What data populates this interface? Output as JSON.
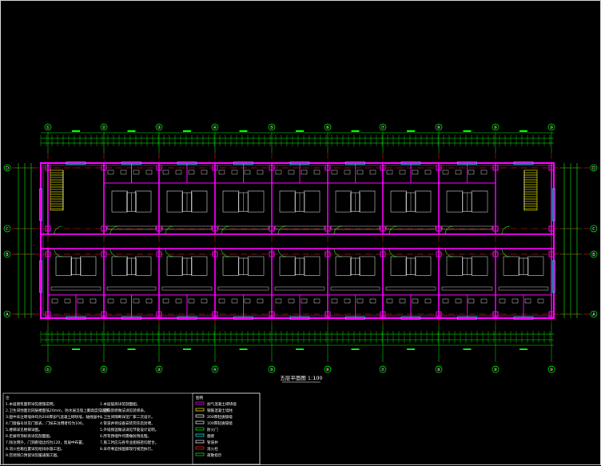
{
  "drawing": {
    "title": "五层平面图 1:100",
    "axis_labels_horizontal": [
      "①",
      "②",
      "③",
      "④",
      "⑤",
      "⑥",
      "⑦",
      "⑧",
      "⑨",
      "⑩"
    ],
    "axis_labels_vertical": [
      "D",
      "C",
      "B",
      "A"
    ],
    "layer_colors": {
      "background": "#000000",
      "walls": "#ff00ff",
      "dimensions": "#00ff00",
      "axis": "#ff2020",
      "furniture": "#ffffff",
      "stair": "#ffff00",
      "windows": "#00ffff"
    }
  },
  "notes": {
    "heading": "注",
    "left_column": [
      "1.本层建筑面积详见建施说明。",
      "2.卫生间地面比同层楼面低20mm，防水层沿墙上翻高度见说明。",
      "3.图中未注明墙体均为200厚加气混凝土砌块墙，轴线居中。",
      "4.门窗编号详见门窗表，门垛未注明者均为100。",
      "5.楼梯详见楼梯详图。",
      "6.走廊吊顶标高详见剖面图。",
      "7.除注明外，门洞距墙边均为120，窗居中布置。",
      "8.消火栓箱位置详见给排水施工图。",
      "9.空调洞口预留详见暖通施工图。"
    ],
    "middle_column": [
      "1.本层层高详见剖面图。",
      "2.室内装修做法详见装修表。",
      "3.卫生间隔断详见厂家二次设计。",
      "4.管道井待设备安装完毕后封堵。",
      "5.外墙保温做法详见节能设计说明。",
      "6.所有预埋件均需做防锈处理。",
      "7.施工时应与各专业图纸密切配合。",
      "8.未尽事宜按国家现行规范执行。"
    ],
    "legend_title": "图例",
    "legend": [
      "加气混凝土砌块墙",
      "钢筋混凝土墙柱",
      "200厚轻质隔墙",
      "100厚轻质隔墙",
      "防火门",
      "烟感",
      "管道井",
      "消火栓",
      "疏散指示"
    ]
  }
}
